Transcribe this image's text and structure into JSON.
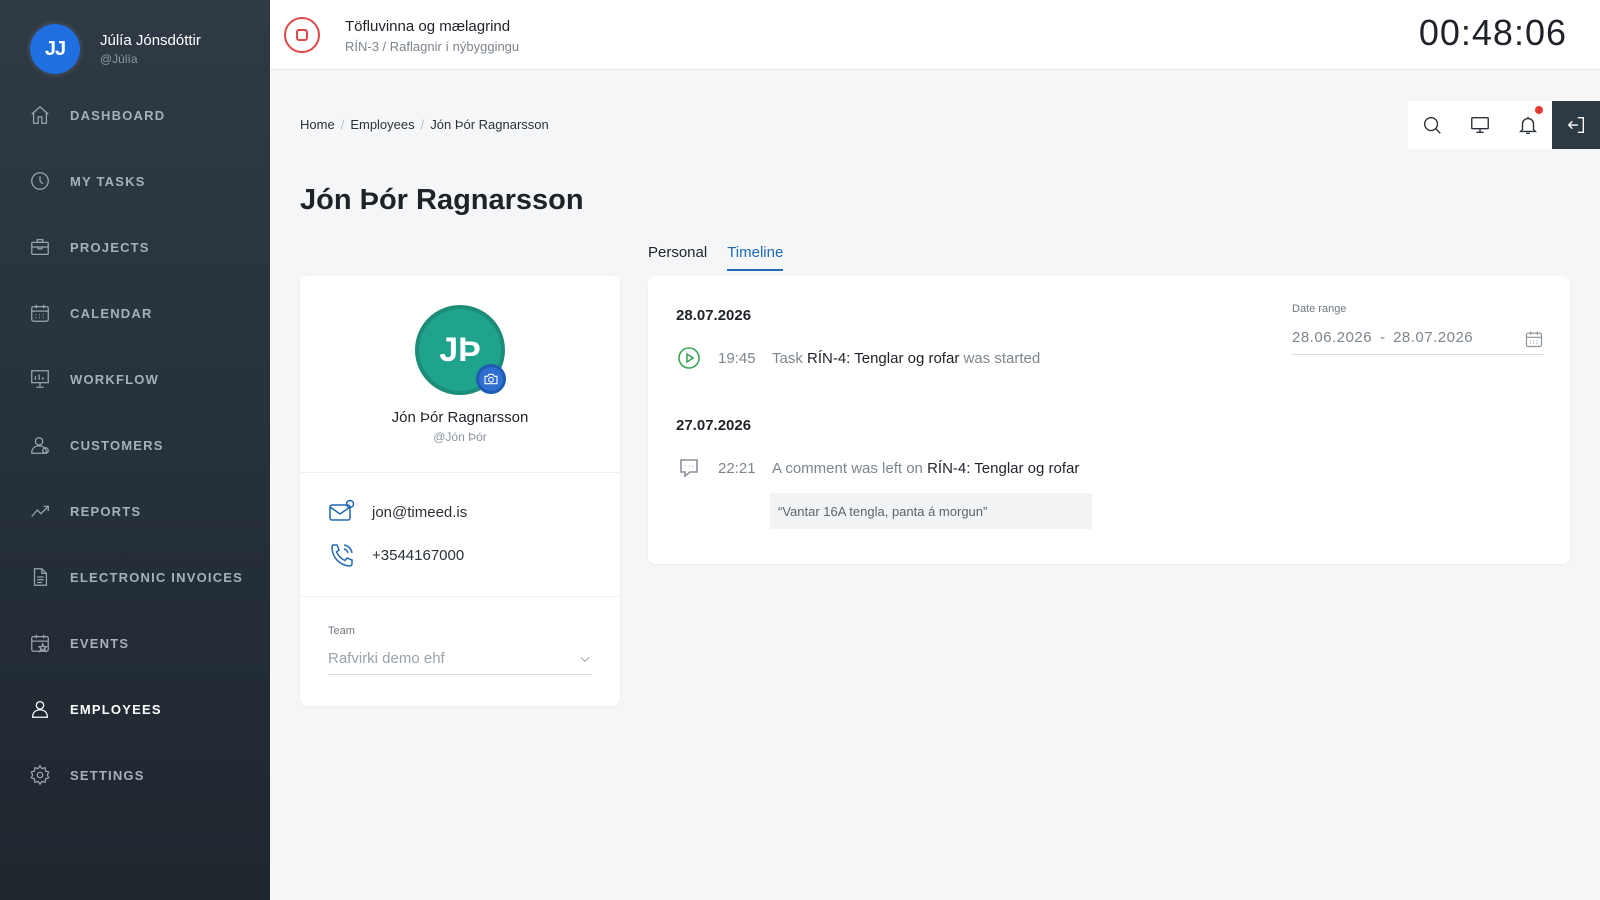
{
  "user": {
    "initials": "JJ",
    "name": "Júlía Jónsdóttir",
    "handle": "@Júlía"
  },
  "nav": [
    {
      "label": "DASHBOARD",
      "icon": "home-icon"
    },
    {
      "label": "MY TASKS",
      "icon": "clock-icon"
    },
    {
      "label": "PROJECTS",
      "icon": "briefcase-icon"
    },
    {
      "label": "CALENDAR",
      "icon": "calendar-icon"
    },
    {
      "label": "WORKFLOW",
      "icon": "workflow-board-icon"
    },
    {
      "label": "CUSTOMERS",
      "icon": "customer-icon"
    },
    {
      "label": "REPORTS",
      "icon": "trend-chart-icon"
    },
    {
      "label": "ELECTRONIC INVOICES",
      "icon": "document-icon"
    },
    {
      "label": "EVENTS",
      "icon": "calendar-star-icon"
    },
    {
      "label": "EMPLOYEES",
      "icon": "employees-icon",
      "active": true
    },
    {
      "label": "SETTINGS",
      "icon": "gear-icon"
    }
  ],
  "active_task": {
    "title": "Töfluvinna og mælagrind",
    "subtitle": "RÍN-3 / Raflagnir í nýbyggingu",
    "timer": "00:48:06"
  },
  "breadcrumb": {
    "home": "Home",
    "employees": "Employees",
    "current": "Jón Þór Ragnarsson"
  },
  "page_title": "Jón Þór Ragnarsson",
  "tabs": {
    "personal": "Personal",
    "timeline": "Timeline",
    "active": "Timeline"
  },
  "employee": {
    "initials": "JÞ",
    "name": "Jón Þór Ragnarsson",
    "handle": "@Jón Þór",
    "email": "jon@timeed.is",
    "phone": "+3544167000",
    "team_label": "Team",
    "team_value": "Rafvirki demo ehf"
  },
  "timeline": {
    "date_range_label": "Date range",
    "date_from": "28.06.2026",
    "date_sep": "-",
    "date_to": "28.07.2026",
    "days": [
      {
        "date": "28.07.2026",
        "event": {
          "time": "19:45",
          "prefix": "Task",
          "task": "RÍN-4: Tenglar og rofar",
          "suffix": "was started"
        }
      },
      {
        "date": "27.07.2026",
        "event": {
          "time": "22:21",
          "prefix": "A comment was left on",
          "task": "RÍN-4: Tenglar og rofar",
          "comment": "“Vantar 16A tengla, panta á morgun”"
        }
      }
    ]
  },
  "colors": {
    "accent": "#2069b3",
    "stop": "#e04848",
    "avatar_user": "#1f6fe0",
    "avatar_employee": "#20a38c",
    "started": "#3aa757",
    "notification": "#e53935"
  }
}
